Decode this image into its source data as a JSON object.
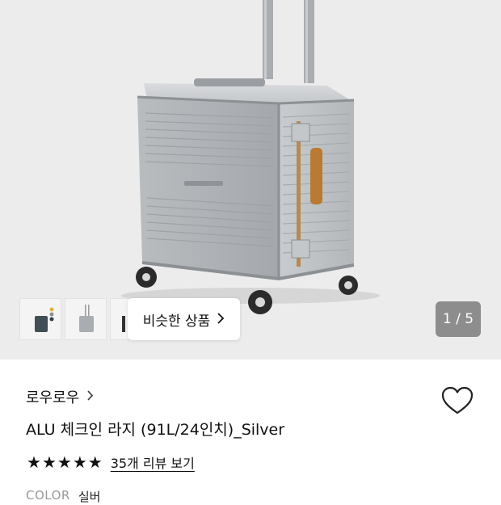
{
  "gallery": {
    "similar_products_label": "비슷한 상품",
    "counter": "1 / 5",
    "thumbnails": [
      "thumbnail-1",
      "thumbnail-2",
      "thumbnail-3"
    ]
  },
  "product": {
    "brand": "로우로우",
    "title": "ALU 체크인 라지 (91L/24인치)_Silver",
    "rating_stars": 5,
    "review_link": "35개 리뷰 보기",
    "color_label": "COLOR",
    "color_value": "실버"
  },
  "icons": {
    "like": "heart-outline-icon",
    "brand_chevron": "chevron-right-icon",
    "similar_chevron": "chevron-right-icon",
    "star": "star-filled-icon"
  },
  "colors": {
    "gallery_bg": "#ececec",
    "counter_bg": "#8d8d8d",
    "text": "#111111",
    "muted": "#999999"
  }
}
